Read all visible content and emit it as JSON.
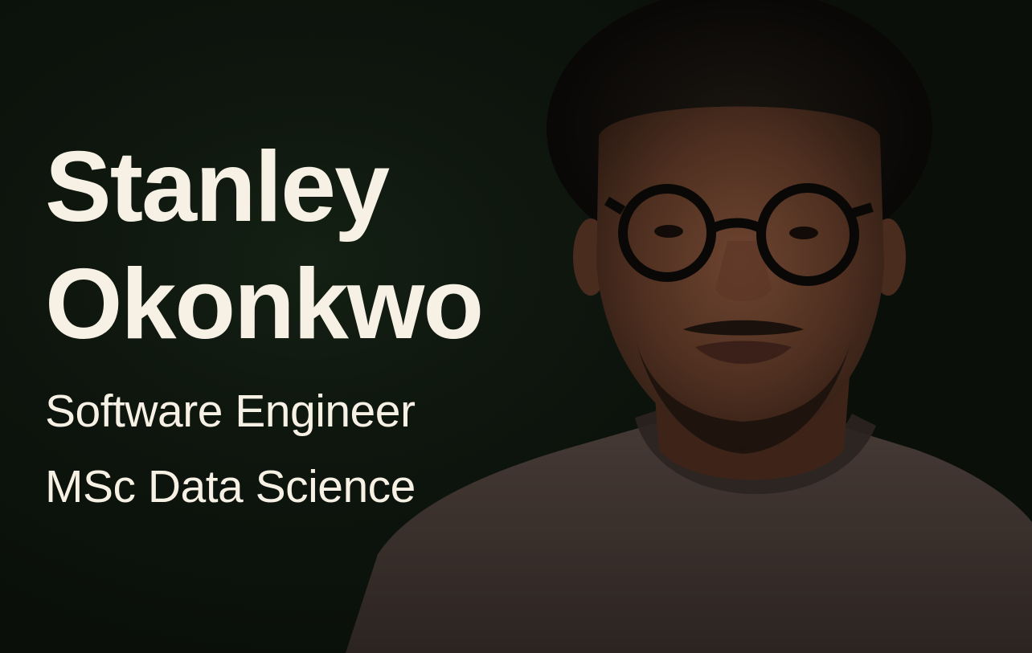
{
  "profile": {
    "first_name": "Stanley",
    "last_name": "Okonkwo",
    "role": "Software Engineer",
    "degree": "MSc Data Science"
  },
  "colors": {
    "background": "#0c130c",
    "text": "#f6f1e4",
    "shirt": "#3a302c",
    "skin": "#5a3624",
    "hair": "#0d0b08"
  },
  "image": {
    "portrait_icon": "person-portrait-icon"
  }
}
